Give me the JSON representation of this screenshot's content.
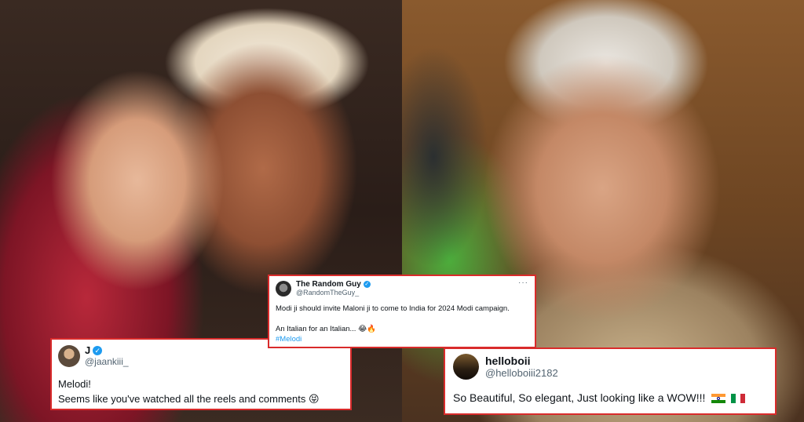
{
  "tweets": {
    "j": {
      "name": "J",
      "handle": "@jaankiii_",
      "verified": true,
      "line1": "Melodi!",
      "line2": "Seems like you've watched all the reels and comments 😝"
    },
    "random_guy": {
      "name": "The Random Guy",
      "handle": "@RandomTheGuy_",
      "verified": true,
      "more": "···",
      "line1": "Modi ji should invite Maloni ji to come to India for 2024 Modi campaign.",
      "line2": "An Italian for an Italian... 😂🔥",
      "hashtag": "#Melodi"
    },
    "helloboii": {
      "name": "helloboii",
      "handle": "@helloboiii2182",
      "verified": false,
      "text": "So Beautiful, So elegant, Just looking like a WOW!!!"
    }
  },
  "icons": {
    "verified": "verified-badge-icon",
    "flags": [
      "india-flag-icon",
      "italy-flag-icon"
    ]
  },
  "colors": {
    "card_border": "#d92b2b",
    "verified": "#1d9bf0",
    "hashtag": "#1d9bf0",
    "handle": "#536471"
  }
}
